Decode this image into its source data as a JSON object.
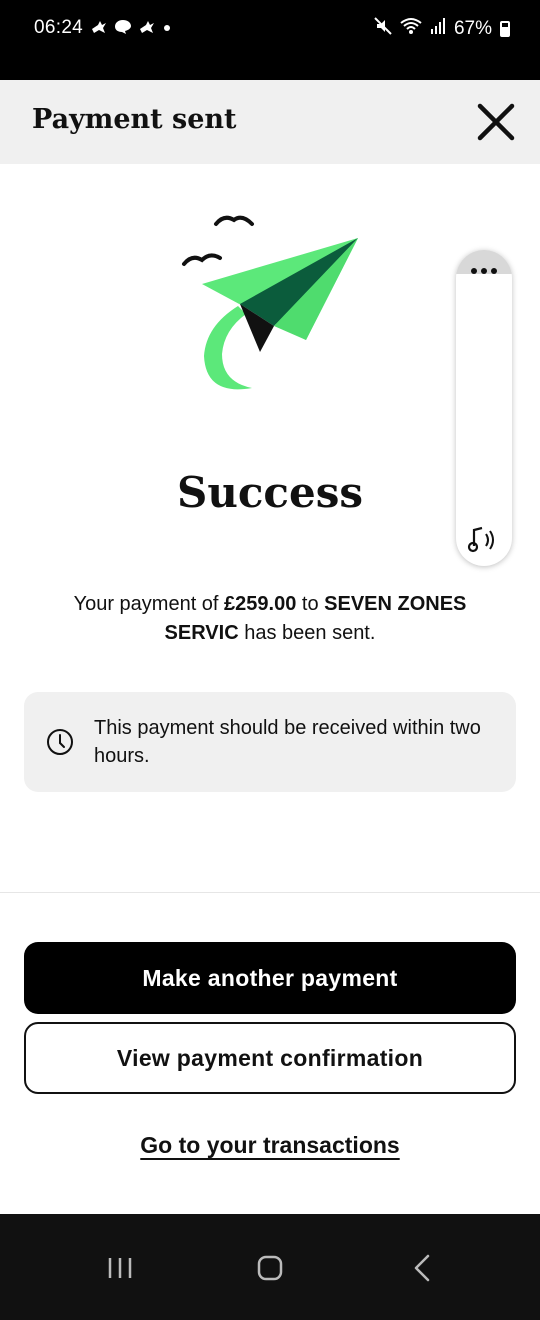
{
  "status_bar": {
    "time": "06:24",
    "left_icons": [
      "notification-icon",
      "chat-icon",
      "notification-icon",
      "dot-icon"
    ],
    "battery": "67%",
    "right_icons": [
      "mute-icon",
      "wifi-icon",
      "signal-icon",
      "battery-icon"
    ]
  },
  "header": {
    "title": "Payment sent",
    "close_icon": "close-icon"
  },
  "success": {
    "title": "Success"
  },
  "message": {
    "part1": "Your payment of ",
    "amount": "£259.00",
    "part2": " to ",
    "payee": "SEVEN ZONES SERVIC",
    "part3": " has been sent."
  },
  "info": {
    "text": "This payment should be received within two hours.",
    "icon": "clock-icon"
  },
  "actions": {
    "primary_label": "Make another payment",
    "secondary_label": "View payment confirmation",
    "link_label": "Go to your transactions"
  },
  "colors": {
    "accent_green": "#5ce87a",
    "dark_green": "#0b5c3c",
    "primary_button": "#000000",
    "header_bg": "#f0f0f0"
  }
}
